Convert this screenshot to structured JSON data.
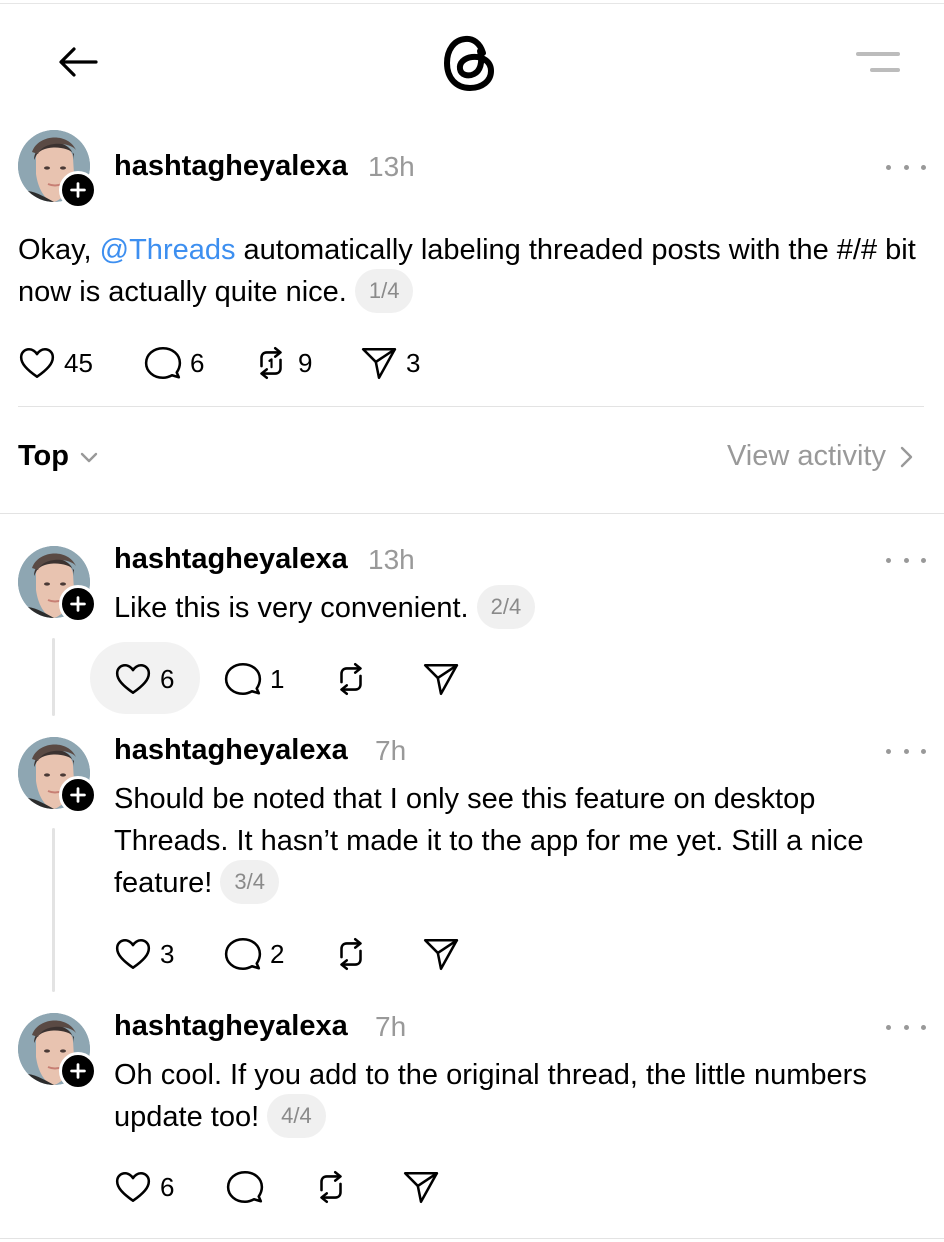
{
  "header": {
    "back_icon": "arrow-left-icon",
    "logo_icon": "threads-logo",
    "menu_icon": "menu-icon"
  },
  "main_post": {
    "username": "hashtagheyalexa",
    "time": "13h",
    "text_before": "Okay, ",
    "mention": "@Threads",
    "text_after": " automatically labeling threaded posts with the #/# bit now is actually quite nice.",
    "page": "1/4",
    "likes": "45",
    "replies": "6",
    "reposts": "9",
    "shares": "3"
  },
  "sort": {
    "label": "Top",
    "view_activity": "View activity"
  },
  "replies": [
    {
      "username": "hashtagheyalexa",
      "time": "13h",
      "text": "Like this is very convenient.",
      "page": "2/4",
      "likes": "6",
      "replies": "1"
    },
    {
      "username": "hashtagheyalexa",
      "time": "7h",
      "text": "Should be noted that I only see this feature on desktop Threads. It hasn’t made it to the app for me yet. Still a nice feature!",
      "page": "3/4",
      "likes": "3",
      "replies": "2"
    },
    {
      "username": "hashtagheyalexa",
      "time": "7h",
      "text": "Oh cool. If you add to the original thread, the little numbers update too!",
      "page": "4/4",
      "likes": "6",
      "replies": ""
    }
  ],
  "colors": {
    "mention": "#3d8ff0",
    "muted": "#999999",
    "divider": "#e3e3e3",
    "pill_bg": "#f0f0f0"
  }
}
